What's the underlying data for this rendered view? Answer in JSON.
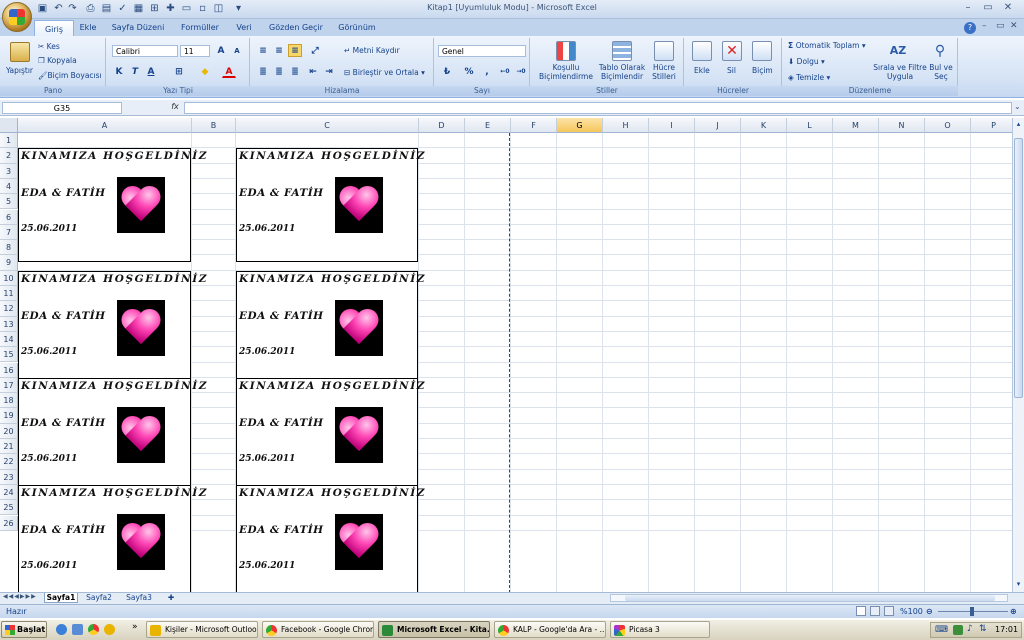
{
  "window": {
    "title": "Kitap1  [Uyumluluk Modu]  -  Microsoft Excel"
  },
  "tabs": [
    "Giriş",
    "Ekle",
    "Sayfa Düzeni",
    "Formüller",
    "Veri",
    "Gözden Geçir",
    "Görünüm"
  ],
  "ribbon": {
    "pano": {
      "label": "Pano",
      "paste": "Yapıştır",
      "cut": "Kes",
      "copy": "Kopyala",
      "format_painter": "Biçim Boyacısı"
    },
    "font": {
      "label": "Yazı Tipi",
      "name": "Calibri",
      "size": "11",
      "bold": "K",
      "italic": "T",
      "underline": "A",
      "color": "A"
    },
    "align": {
      "label": "Hizalama",
      "wrap": "Metni Kaydır",
      "merge": "Birleştir ve Ortala"
    },
    "number": {
      "label": "Sayı",
      "format": "Genel",
      "percent": "%"
    },
    "styles": {
      "label": "Stiller",
      "conditional": "Koşullu Biçimlendirme",
      "table": "Tablo Olarak Biçimlendir",
      "cell": "Hücre Stilleri"
    },
    "cells": {
      "label": "Hücreler",
      "insert": "Ekle",
      "delete": "Sil",
      "format": "Biçim"
    },
    "edit": {
      "label": "Düzenleme",
      "autosum": "Otomatik Toplam",
      "fill": "Dolgu",
      "clear": "Temizle",
      "sort": "Sırala ve Filtre Uygula",
      "find": "Bul ve Seç"
    }
  },
  "namebox": "G35",
  "fx": "fx",
  "columns": [
    "A",
    "B",
    "C",
    "D",
    "E",
    "F",
    "G",
    "H",
    "I",
    "J",
    "K",
    "L",
    "M",
    "N",
    "O",
    "P"
  ],
  "selected_column": "G",
  "rows": [
    "1",
    "2",
    "3",
    "4",
    "5",
    "6",
    "7",
    "8",
    "9",
    "10",
    "11",
    "12",
    "13",
    "14",
    "15",
    "16",
    "17",
    "18",
    "19",
    "20",
    "21",
    "22",
    "23",
    "24",
    "25",
    "26"
  ],
  "card": {
    "welcome": "KINAMIZA  HOŞGELDİNİZ",
    "names": "EDA & FATİH",
    "date": "25.06.2011"
  },
  "sheets": [
    "Sayfa1",
    "Sayfa2",
    "Sayfa3"
  ],
  "status": {
    "ready": "Hazır",
    "zoom": "%100"
  },
  "taskbar": {
    "start": "Başlat",
    "items": [
      "Kişiler - Microsoft Outlook",
      "Facebook - Google Chrome",
      "Microsoft Excel - Kita...",
      "KALP - Google'da Ara - ...",
      "Picasa 3"
    ],
    "active": 2,
    "clock": "17:01"
  },
  "colors": {
    "accent": "#15428b",
    "ribbon": "#d5e3f5",
    "heart": "#ff46b5",
    "selected_col": "#f6c65a"
  }
}
